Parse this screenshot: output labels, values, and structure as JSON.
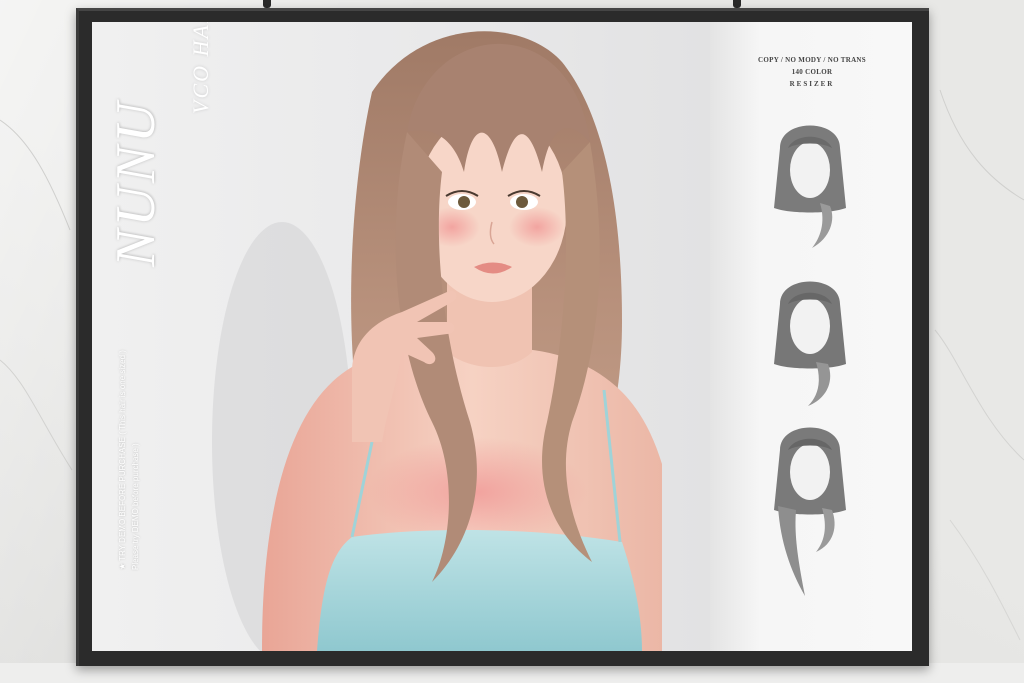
{
  "brand": {
    "name": "NUNU",
    "product": "VCO HAIR"
  },
  "notice": {
    "line1": "★ TRY DEMO BEFORE PURCHASE ( This hair is one sized )",
    "line2": "Please try DEMO before purchase )"
  },
  "permissions": {
    "line1": "COPY / NO MODY / NO TRANS",
    "line2": "140 COLOR",
    "line3": "RESIZER"
  },
  "colors": {
    "frame": "#2b2b2b",
    "hair": "#b48a73",
    "skin": "#f2c2b0",
    "top": "#a9d7dc",
    "swatch_hair": "#7a7a7a"
  },
  "swatches": [
    {
      "style": "short-bob"
    },
    {
      "style": "medium-bob"
    },
    {
      "style": "long-layered"
    }
  ]
}
